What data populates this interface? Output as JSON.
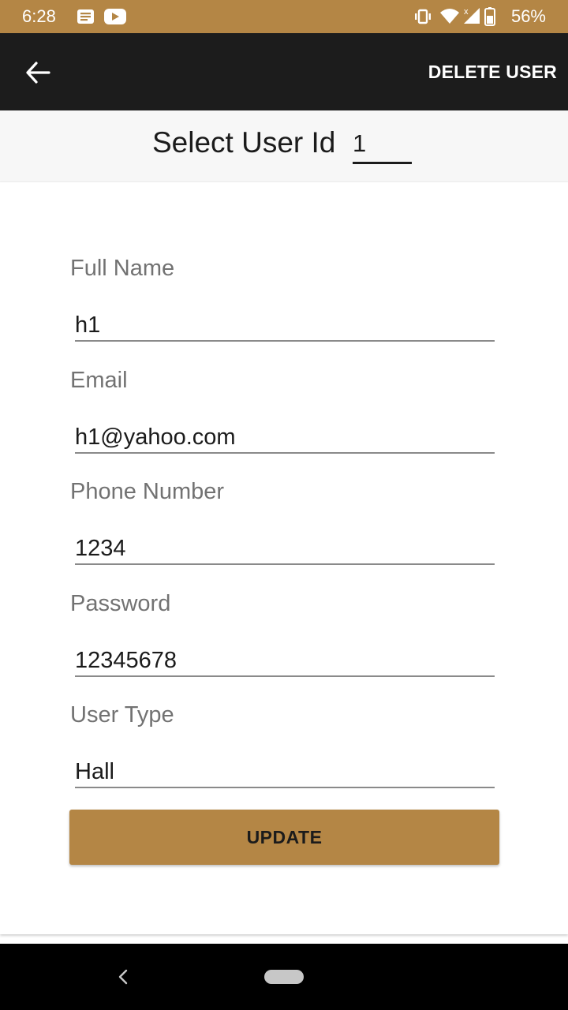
{
  "status_bar": {
    "time": "6:28",
    "battery_percent": "56%",
    "icons": [
      "notes-icon",
      "youtube-icon",
      "vibrate-icon",
      "wifi-icon",
      "signal-icon",
      "battery-icon"
    ],
    "background_color": "#b48645"
  },
  "app_bar": {
    "back_icon": "arrow-left-icon",
    "action_label": "DELETE USER",
    "background_color": "#1c1c1c"
  },
  "select_user": {
    "label": "Select User Id",
    "selected_value": "1"
  },
  "form": {
    "fields": [
      {
        "label": "Full Name",
        "value": "h1"
      },
      {
        "label": "Email",
        "value": "h1@yahoo.com"
      },
      {
        "label": "Phone Number",
        "value": "1234"
      },
      {
        "label": "Password",
        "value": "12345678"
      },
      {
        "label": "User Type",
        "value": "Hall"
      }
    ],
    "submit_label": "UPDATE",
    "accent_color": "#b48645"
  },
  "nav_bar": {
    "icons": [
      "nav-back-icon",
      "home-pill-icon"
    ]
  }
}
